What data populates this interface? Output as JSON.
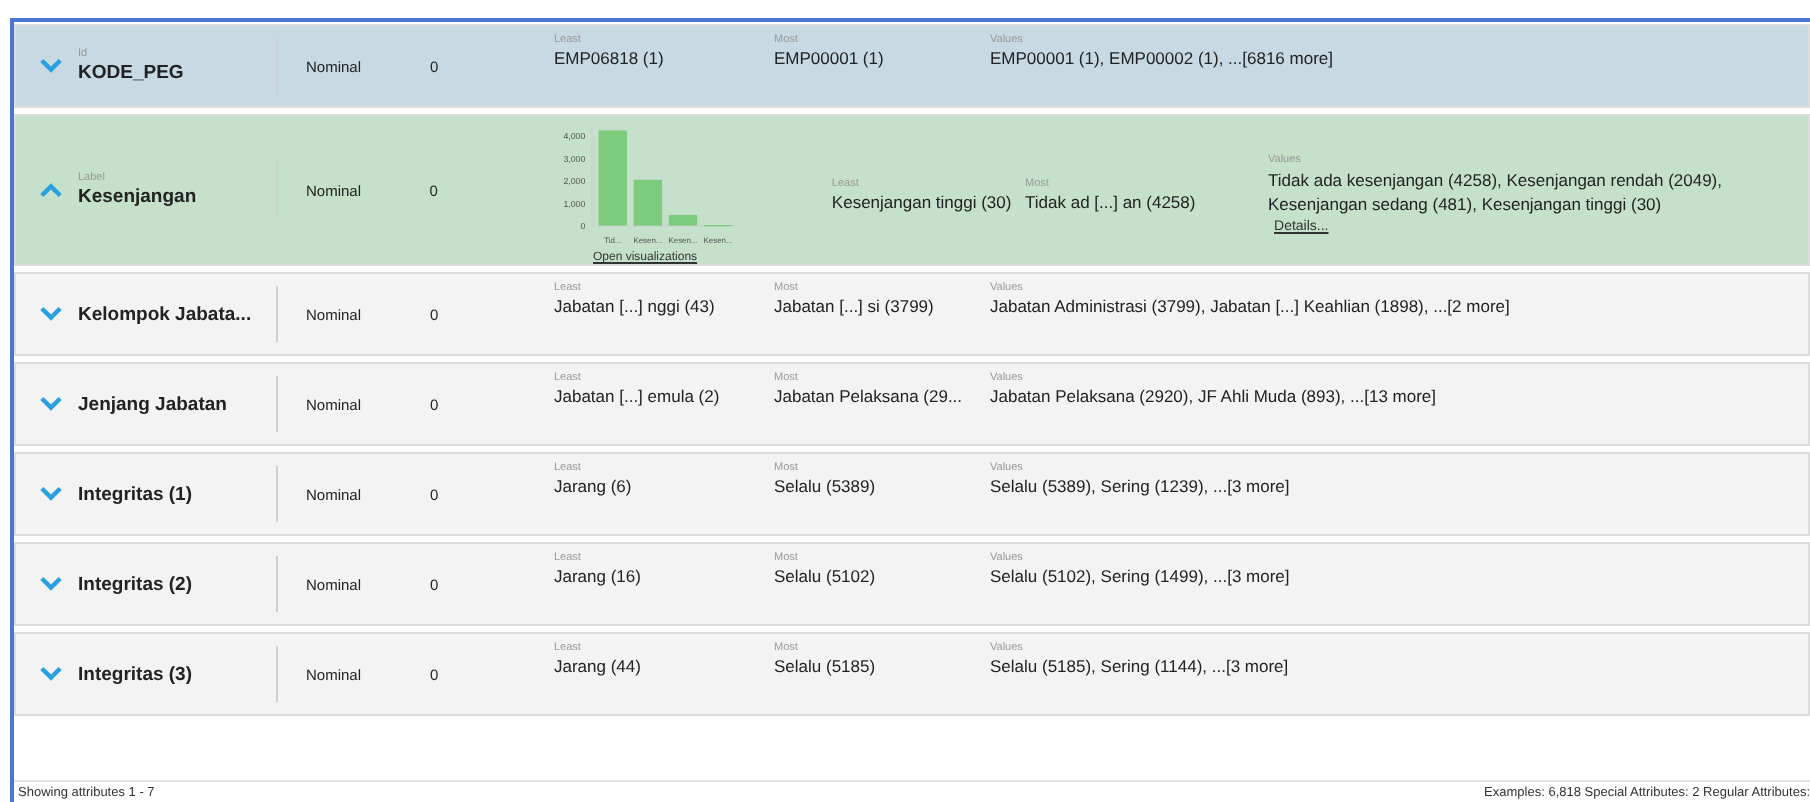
{
  "attributes": [
    {
      "kind": "id",
      "role": "Id",
      "name": "KODE_PEG",
      "expanded": false,
      "type": "Nominal",
      "missing": "0",
      "least_label": "Least",
      "least": "EMP06818 (1)",
      "most_label": "Most",
      "most": "EMP00001 (1)",
      "values_label": "Values",
      "values": "EMP00001 (1), EMP00002 (1), ...[6816 more]"
    },
    {
      "kind": "label",
      "role": "Label",
      "name": "Kesenjangan",
      "expanded": true,
      "type": "Nominal",
      "missing": "0",
      "least_label": "Least",
      "least": "Kesenjangan tinggi (30)",
      "most_label": "Most",
      "most": "Tidak ad [...] an (4258)",
      "values_label": "Values",
      "values": "Tidak ada kesenjangan (4258), Kesenjangan rendah (2049), Kesenjangan sedang (481), Kesenjangan tinggi (30)",
      "details_link": "Details...",
      "visualizations_link": "Open visualizations",
      "chart_data": {
        "type": "bar",
        "categories": [
          "Tid...",
          "Kesen...",
          "Kesen...",
          "Kesen..."
        ],
        "values": [
          4250,
          2050,
          480,
          30
        ],
        "ylim": [
          0,
          4500
        ],
        "yticks": [
          0,
          {
            "value": 1000,
            "label": "1,000"
          },
          {
            "value": 2000,
            "label": "2,000"
          },
          {
            "value": 3000,
            "label": "3,000"
          },
          {
            "value": 4000,
            "label": "4,000"
          }
        ]
      }
    },
    {
      "kind": "regular",
      "name": "Kelompok Jabata...",
      "expanded": false,
      "type": "Nominal",
      "missing": "0",
      "least_label": "Least",
      "least": "Jabatan  [...] nggi (43)",
      "most_label": "Most",
      "most": "Jabatan  [...] si (3799)",
      "values_label": "Values",
      "values": "Jabatan Administrasi (3799), Jabatan  [...]  Keahlian (1898), ...[2 more]"
    },
    {
      "kind": "regular",
      "name": "Jenjang Jabatan",
      "expanded": false,
      "type": "Nominal",
      "missing": "0",
      "least_label": "Least",
      "least": "Jabatan  [...] emula (2)",
      "most_label": "Most",
      "most": "Jabatan Pelaksana (29...",
      "values_label": "Values",
      "values": "Jabatan Pelaksana (2920), JF Ahli Muda (893), ...[13 more]"
    },
    {
      "kind": "regular",
      "name": "Integritas (1)",
      "expanded": false,
      "type": "Nominal",
      "missing": "0",
      "least_label": "Least",
      "least": "Jarang (6)",
      "most_label": "Most",
      "most": "Selalu (5389)",
      "values_label": "Values",
      "values": "Selalu (5389), Sering (1239), ...[3 more]"
    },
    {
      "kind": "regular",
      "name": "Integritas (2)",
      "expanded": false,
      "type": "Nominal",
      "missing": "0",
      "least_label": "Least",
      "least": "Jarang (16)",
      "most_label": "Most",
      "most": "Selalu (5102)",
      "values_label": "Values",
      "values": "Selalu (5102), Sering (1499), ...[3 more]"
    },
    {
      "kind": "regular",
      "name": "Integritas (3)",
      "expanded": false,
      "type": "Nominal",
      "missing": "0",
      "least_label": "Least",
      "least": "Jarang (44)",
      "most_label": "Most",
      "most": "Selalu (5185)",
      "values_label": "Values",
      "values": "Selalu (5185), Sering (1144), ...[3 more]"
    }
  ],
  "status_bar": {
    "left": "Showing attributes 1 - 7",
    "right": "Examples: 6,818   Special Attributes: 2   Regular Attributes:"
  }
}
